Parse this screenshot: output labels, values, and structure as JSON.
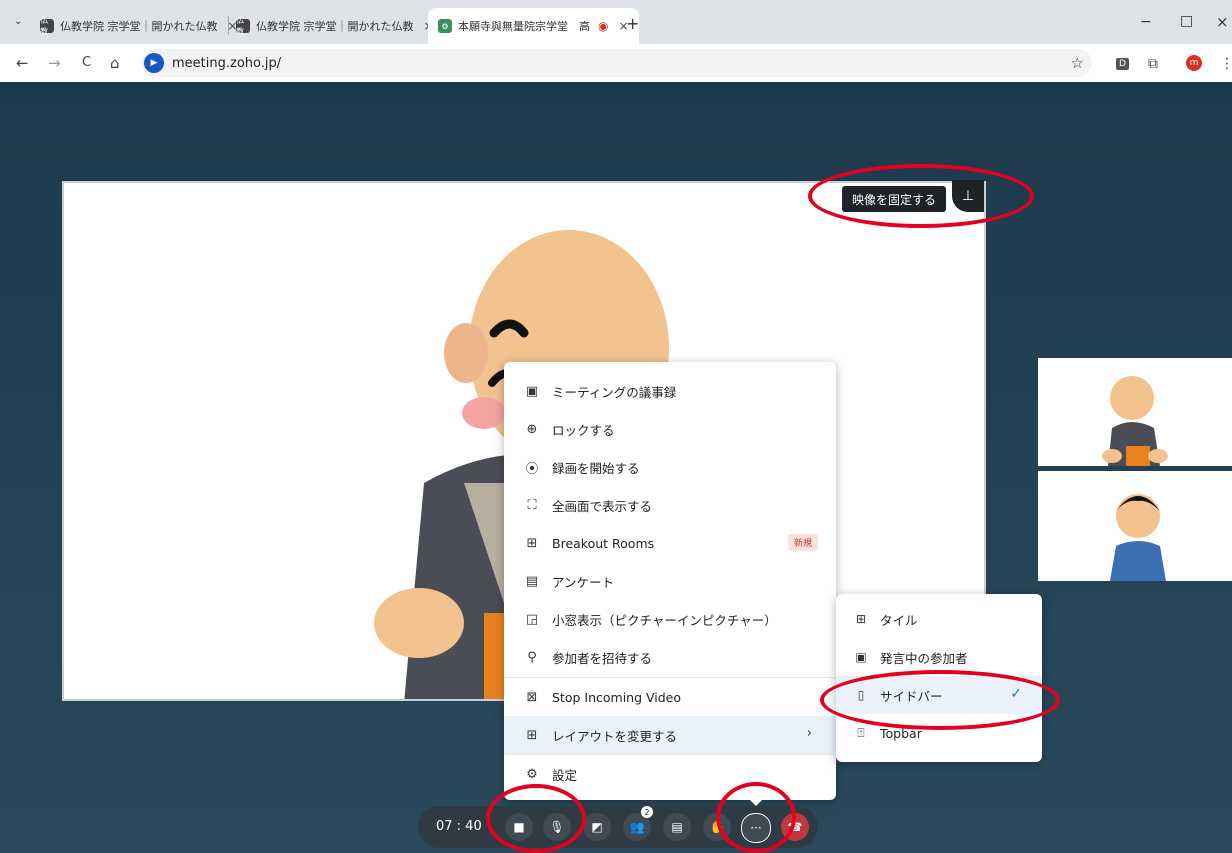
{
  "browser": {
    "tabs": [
      {
        "favicon": "仏教",
        "title": "仏教学院 宗学堂｜開かれた仏教",
        "close": "×"
      },
      {
        "favicon": "仏教",
        "title": "仏教学院 宗学堂｜開かれた仏教",
        "close": "×"
      },
      {
        "favicon": "⚙",
        "title": "本願寺與無量院宗学堂　高",
        "close": "×"
      }
    ],
    "new_tab": "+",
    "window_controls": {
      "minimize": "−",
      "maximize": "□",
      "close": "×"
    },
    "url": "meeting.zoho.jp/",
    "nav": {
      "back": "←",
      "forward": "→",
      "reload": "C",
      "home": "⌂"
    },
    "right_icons": {
      "star": "☆",
      "ext_d": "D",
      "puzzle": "⧉",
      "profile": "m",
      "menu": "⋮"
    }
  },
  "video": {
    "pin_tooltip": "映像を固定する",
    "pin_icon": "pin-icon"
  },
  "more_menu": {
    "items": [
      {
        "icon": "notes-icon",
        "glyph": "▣",
        "label": "ミーティングの議事録"
      },
      {
        "icon": "lock-icon",
        "glyph": "⊕",
        "label": "ロックする"
      },
      {
        "icon": "record-icon",
        "glyph": "⦿",
        "label": "録画を開始する"
      },
      {
        "icon": "fullscreen-icon",
        "glyph": "⛶",
        "label": "全画面で表示する"
      },
      {
        "icon": "breakout-icon",
        "glyph": "⊞",
        "label": "Breakout Rooms",
        "badge": "新規"
      },
      {
        "icon": "poll-icon",
        "glyph": "▤",
        "label": "アンケート"
      },
      {
        "icon": "pip-icon",
        "glyph": "◲",
        "label": "小窓表示（ピクチャーインピクチャー）"
      },
      {
        "icon": "add-person-icon",
        "glyph": "⚲",
        "label": "参加者を招待する"
      },
      {
        "icon": "video-off-icon",
        "glyph": "⊠",
        "label": "Stop Incoming Video"
      },
      {
        "icon": "layout-icon",
        "glyph": "⊞",
        "label": "レイアウトを変更する",
        "chevron": "›"
      },
      {
        "icon": "settings-icon",
        "glyph": "⚙",
        "label": "設定"
      }
    ]
  },
  "layout_menu": {
    "items": [
      {
        "icon": "tile-icon",
        "glyph": "⊞",
        "label": "タイル"
      },
      {
        "icon": "speaker-icon",
        "glyph": "▣",
        "label": "発言中の参加者"
      },
      {
        "icon": "sidebar-icon",
        "glyph": "▯",
        "label": "サイドバー",
        "selected": true,
        "check": "✓"
      },
      {
        "icon": "topbar-icon",
        "glyph": "⍐",
        "label": "Topbar"
      }
    ]
  },
  "toolbar": {
    "timer": "07 : 40",
    "participants_count": "2",
    "buttons": [
      {
        "name": "camera-button",
        "glyph": "■"
      },
      {
        "name": "mic-button",
        "glyph": "🎙"
      },
      {
        "name": "share-screen-button",
        "glyph": "◩"
      },
      {
        "name": "participants-button",
        "glyph": "👥"
      },
      {
        "name": "chat-button",
        "glyph": "▤"
      },
      {
        "name": "reaction-button",
        "glyph": "✋"
      },
      {
        "name": "more-button",
        "glyph": "···"
      },
      {
        "name": "leave-button",
        "glyph": "☎"
      }
    ]
  },
  "colors": {
    "annotation": "#e4001e",
    "background": "#203a4c",
    "accent": "#1a73e8"
  }
}
